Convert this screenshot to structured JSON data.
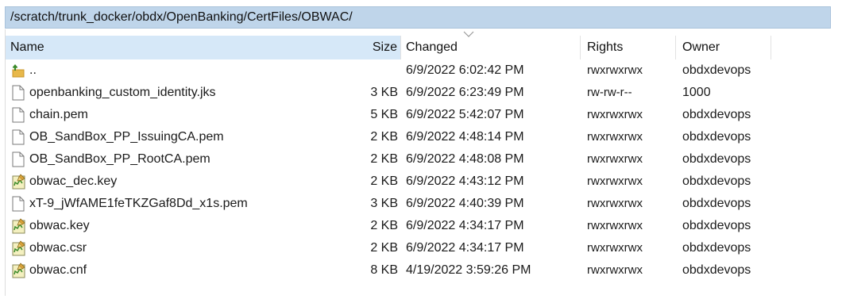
{
  "path": "/scratch/trunk_docker/obdx/OpenBanking/CertFiles/OBWAC/",
  "columns": {
    "name": "Name",
    "size": "Size",
    "changed": "Changed",
    "rights": "Rights",
    "owner": "Owner"
  },
  "files": [
    {
      "icon": "parent-folder-icon",
      "name": "..",
      "size": "",
      "changed": "6/9/2022 6:02:42 PM",
      "rights": "rwxrwxrwx",
      "owner": "obdxdevops"
    },
    {
      "icon": "file-icon",
      "name": "openbanking_custom_identity.jks",
      "size": "3 KB",
      "changed": "6/9/2022 6:23:49 PM",
      "rights": "rw-rw-r--",
      "owner": "1000"
    },
    {
      "icon": "file-icon",
      "name": "chain.pem",
      "size": "5 KB",
      "changed": "6/9/2022 5:42:07 PM",
      "rights": "rwxrwxrwx",
      "owner": "obdxdevops"
    },
    {
      "icon": "file-icon",
      "name": "OB_SandBox_PP_IssuingCA.pem",
      "size": "2 KB",
      "changed": "6/9/2022 4:48:14 PM",
      "rights": "rwxrwxrwx",
      "owner": "obdxdevops"
    },
    {
      "icon": "file-icon",
      "name": "OB_SandBox_PP_RootCA.pem",
      "size": "2 KB",
      "changed": "6/9/2022 4:48:08 PM",
      "rights": "rwxrwxrwx",
      "owner": "obdxdevops"
    },
    {
      "icon": "edit-file-icon",
      "name": "obwac_dec.key",
      "size": "2 KB",
      "changed": "6/9/2022 4:43:12 PM",
      "rights": "rwxrwxrwx",
      "owner": "obdxdevops"
    },
    {
      "icon": "file-icon",
      "name": "xT-9_jWfAME1feTKZGaf8Dd_x1s.pem",
      "size": "3 KB",
      "changed": "6/9/2022 4:40:39 PM",
      "rights": "rwxrwxrwx",
      "owner": "obdxdevops"
    },
    {
      "icon": "edit-file-icon",
      "name": "obwac.key",
      "size": "2 KB",
      "changed": "6/9/2022 4:34:17 PM",
      "rights": "rwxrwxrwx",
      "owner": "obdxdevops"
    },
    {
      "icon": "edit-file-icon",
      "name": "obwac.csr",
      "size": "2 KB",
      "changed": "6/9/2022 4:34:17 PM",
      "rights": "rwxrwxrwx",
      "owner": "obdxdevops"
    },
    {
      "icon": "edit-file-icon",
      "name": "obwac.cnf",
      "size": "8 KB",
      "changed": "4/19/2022 3:59:26 PM",
      "rights": "rwxrwxrwx",
      "owner": "obdxdevops"
    }
  ]
}
